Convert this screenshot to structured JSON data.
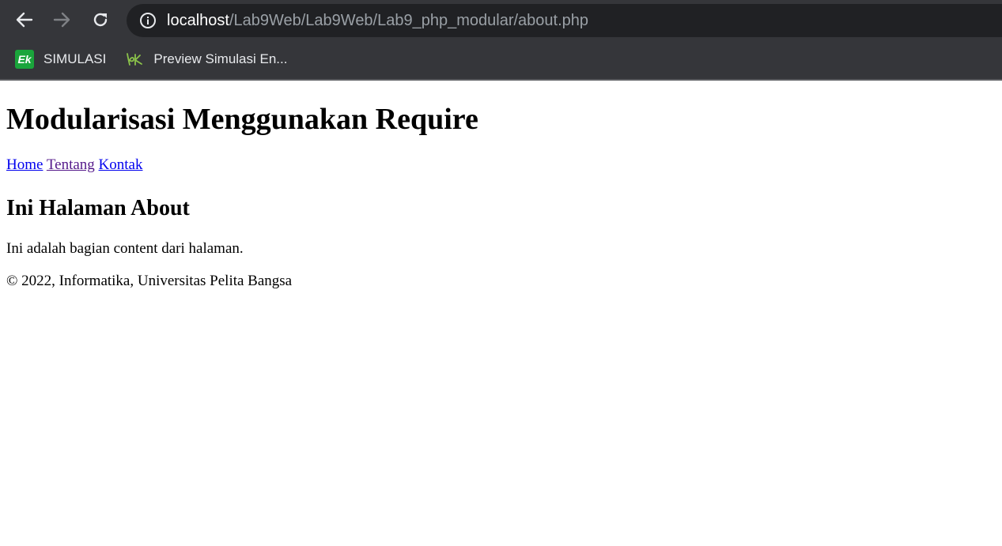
{
  "browser": {
    "url_host": "localhost",
    "url_path": "/Lab9Web/Lab9Web/Lab9_php_modular/about.php",
    "bookmarks": [
      {
        "label": "SIMULASI",
        "favicon_text": "Ek"
      },
      {
        "label": "Preview Simulasi En..."
      }
    ]
  },
  "page": {
    "title": "Modularisasi Menggunakan Require",
    "nav": [
      {
        "label": "Home"
      },
      {
        "label": "Tentang"
      },
      {
        "label": "Kontak"
      }
    ],
    "heading": "Ini Halaman About",
    "content": "Ini adalah bagian content dari halaman.",
    "footer": "© 2022, Informatika, Universitas Pelita Bangsa"
  }
}
